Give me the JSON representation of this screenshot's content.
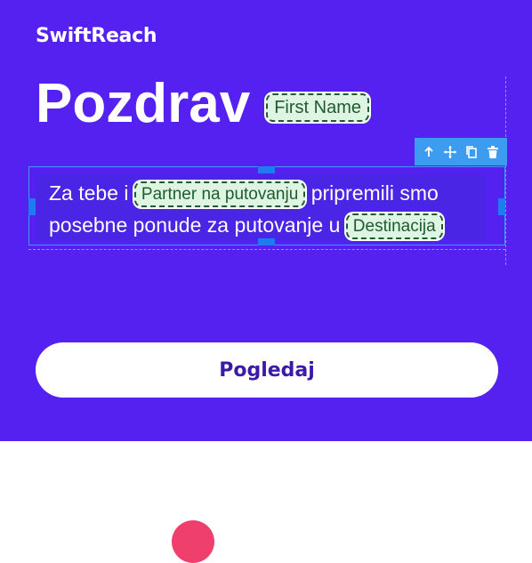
{
  "brand": {
    "name": "SwiftReach"
  },
  "header": {
    "greeting": "Pozdrav",
    "name_tag": "First Name"
  },
  "toolbar": {
    "icons": [
      "arrow-up-icon",
      "move-icon",
      "duplicate-icon",
      "delete-icon"
    ]
  },
  "body_text": {
    "part1": "Za tebe i",
    "tag1": "Partner na putovanju",
    "part2": "pripremili smo posebne ponude za putovanje u",
    "tag2": "Destinacija"
  },
  "cta": {
    "label": "Pogledaj"
  },
  "colors": {
    "hero_bg": "#5521f0",
    "selection": "#3d9cf0",
    "tag_bg": "#dff5e3",
    "tag_text": "#1e5b2e",
    "cta_text": "#3c1aa8",
    "accent_pink": "#ef3f6c"
  }
}
